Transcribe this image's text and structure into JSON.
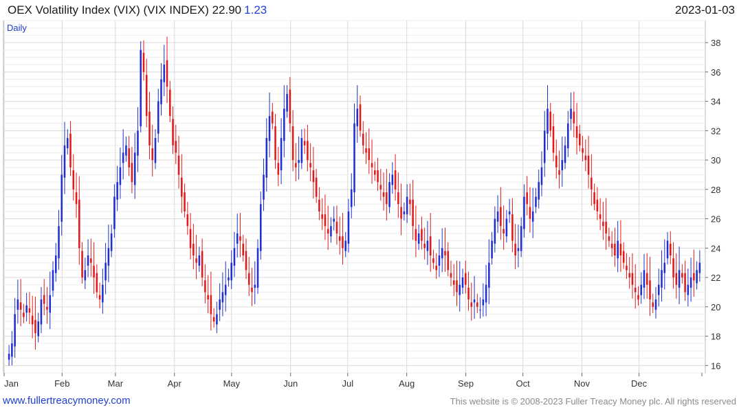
{
  "header": {
    "title": "OEX Volatility Index (VIX) (VIX INDEX) 22.90",
    "change": "1.23",
    "date": "2023-01-03"
  },
  "footer": {
    "site": "www.fullertreacymoney.com",
    "copyright": "This website is © 2008-2023 Fuller Treacy Money plc. All rights reserved"
  },
  "colors": {
    "up": "#1f2fd0",
    "down": "#e01a1a",
    "grid": "#d9d9d9",
    "frame": "#b8b8b8"
  },
  "chart_data": {
    "type": "candlestick",
    "frequency_label": "Daily",
    "grid": true,
    "y_axis_side": "right",
    "ylim": [
      15.5,
      39.5
    ],
    "yticks": [
      16,
      18,
      20,
      22,
      24,
      26,
      28,
      30,
      32,
      34,
      36,
      38
    ],
    "xlabels": [
      "Jan",
      "Feb",
      "Mar",
      "Apr",
      "May",
      "Jun",
      "Jul",
      "Aug",
      "Sep",
      "Oct",
      "Nov",
      "Dec"
    ],
    "x_range": [
      "2022-01-03",
      "2023-01-03"
    ],
    "closes": [
      16.8,
      17.5,
      19.5,
      20.5,
      19.8,
      19.3,
      20.1,
      19.6,
      18.8,
      18.2,
      19.0,
      20.5,
      20.2,
      19.8,
      20.8,
      22.5,
      23.5,
      25.5,
      29.0,
      31.0,
      31.5,
      29.5,
      28.0,
      27.0,
      24.0,
      22.0,
      22.5,
      23.5,
      23.0,
      22.0,
      21.0,
      20.5,
      21.5,
      23.0,
      24.0,
      25.0,
      27.5,
      28.5,
      29.5,
      30.5,
      31.0,
      29.5,
      28.5,
      30.5,
      32.0,
      37.5,
      36.0,
      33.0,
      31.0,
      30.0,
      31.5,
      34.0,
      35.5,
      36.5,
      35.0,
      33.0,
      31.0,
      30.5,
      29.0,
      27.5,
      26.5,
      25.5,
      24.0,
      23.5,
      23.0,
      23.5,
      22.0,
      21.0,
      20.5,
      19.5,
      19.0,
      19.5,
      20.5,
      21.0,
      21.5,
      22.0,
      23.0,
      24.0,
      25.0,
      24.5,
      23.5,
      22.5,
      21.5,
      21.0,
      21.5,
      24.0,
      27.0,
      29.0,
      31.5,
      33.0,
      32.5,
      30.0,
      29.0,
      31.5,
      33.5,
      34.5,
      32.5,
      30.0,
      29.5,
      30.0,
      31.5,
      31.0,
      30.0,
      29.5,
      28.5,
      27.5,
      26.5,
      26.0,
      25.5,
      25.0,
      25.5,
      26.0,
      25.0,
      24.5,
      24.0,
      24.5,
      26.5,
      28.0,
      32.5,
      33.5,
      32.0,
      31.0,
      30.5,
      30.0,
      29.5,
      29.0,
      28.5,
      28.0,
      27.5,
      27.0,
      28.5,
      29.0,
      28.0,
      27.0,
      26.0,
      26.5,
      27.5,
      27.0,
      25.5,
      24.5,
      25.0,
      24.5,
      24.0,
      24.5,
      23.5,
      23.0,
      22.5,
      23.5,
      24.0,
      23.5,
      22.5,
      22.0,
      21.5,
      21.0,
      21.5,
      22.0,
      21.5,
      20.5,
      20.0,
      20.5,
      20.0,
      19.8,
      20.5,
      21.5,
      23.0,
      24.5,
      26.0,
      26.5,
      25.5,
      25.0,
      26.0,
      26.5,
      24.5,
      23.5,
      24.0,
      25.5,
      27.5,
      27.0,
      26.0,
      26.5,
      27.5,
      28.5,
      29.5,
      32.0,
      33.5,
      32.0,
      30.5,
      29.5,
      29.0,
      30.0,
      31.0,
      32.5,
      33.5,
      32.5,
      31.5,
      31.0,
      30.5,
      30.0,
      29.0,
      28.0,
      27.0,
      26.5,
      26.0,
      25.5,
      25.0,
      24.5,
      24.0,
      23.5,
      24.5,
      23.5,
      23.0,
      22.5,
      22.0,
      21.5,
      21.0,
      20.5,
      21.5,
      22.5,
      21.5,
      20.5,
      20.0,
      20.5,
      21.5,
      22.5,
      23.0,
      24.5,
      23.5,
      22.0,
      21.5,
      22.5,
      22.0,
      21.0,
      21.5,
      22.0,
      21.8,
      22.5,
      23.0
    ]
  }
}
